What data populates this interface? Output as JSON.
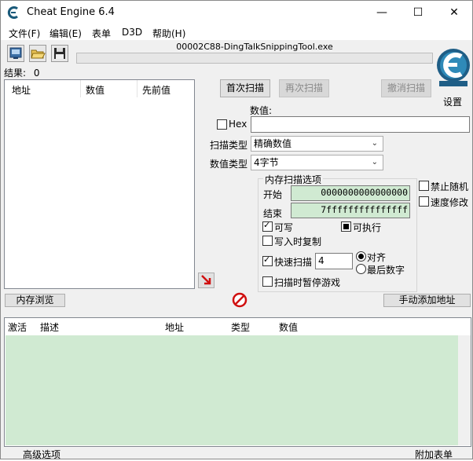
{
  "window": {
    "title": "Cheat Engine 6.4",
    "minimize": "—",
    "maximize": "☐",
    "close": "✕"
  },
  "menu": [
    "文件(F)",
    "编辑(E)",
    "表单",
    "D3D",
    "帮助(H)"
  ],
  "toolbar": {
    "icons": [
      "process-select-icon",
      "open-file-icon",
      "save-icon"
    ]
  },
  "process": {
    "name": "00002C88-DingTalkSnippingTool.exe",
    "progress": 0
  },
  "settings_label": "设置",
  "results": {
    "label": "结果:",
    "count": "0"
  },
  "found_list": {
    "columns": [
      "地址",
      "数值",
      "先前值"
    ]
  },
  "scan": {
    "first_scan": "首次扫描",
    "next_scan": "再次扫描",
    "undo_scan": "撤消扫描",
    "value_label": "数值:",
    "hex_label": "Hex",
    "hex_checked": false,
    "value_input": "",
    "scan_type_label": "扫描类型",
    "scan_type_value": "精确数值",
    "value_type_label": "数值类型",
    "value_type_value": "4字节"
  },
  "memory_options": {
    "title": "内存扫描选项",
    "start_label": "开始",
    "start_value": "0000000000000000",
    "stop_label": "结束",
    "stop_value": "7fffffffffffffff",
    "writable": "可写",
    "writable_checked": true,
    "executable": "可执行",
    "executable_state": "indeterminate",
    "copy_on_write": "写入时复制",
    "copy_on_write_checked": false,
    "fast_scan": "快速扫描",
    "fast_scan_checked": true,
    "fast_scan_value": "4",
    "align": "对齐",
    "last_digits": "最后数字",
    "align_selected": true,
    "pause_game": "扫描时暂停游戏",
    "pause_game_checked": false
  },
  "side_options": {
    "disable_random": "禁止随机",
    "disable_random_checked": false,
    "speed_hack": "速度修改",
    "speed_hack_checked": false
  },
  "buttons": {
    "memory_view": "内存浏览",
    "add_address": "手动添加地址"
  },
  "address_list": {
    "columns": [
      "激活",
      "描述",
      "地址",
      "类型",
      "数值"
    ]
  },
  "footer": {
    "advanced": "高级选项",
    "table_extras": "附加表单"
  }
}
